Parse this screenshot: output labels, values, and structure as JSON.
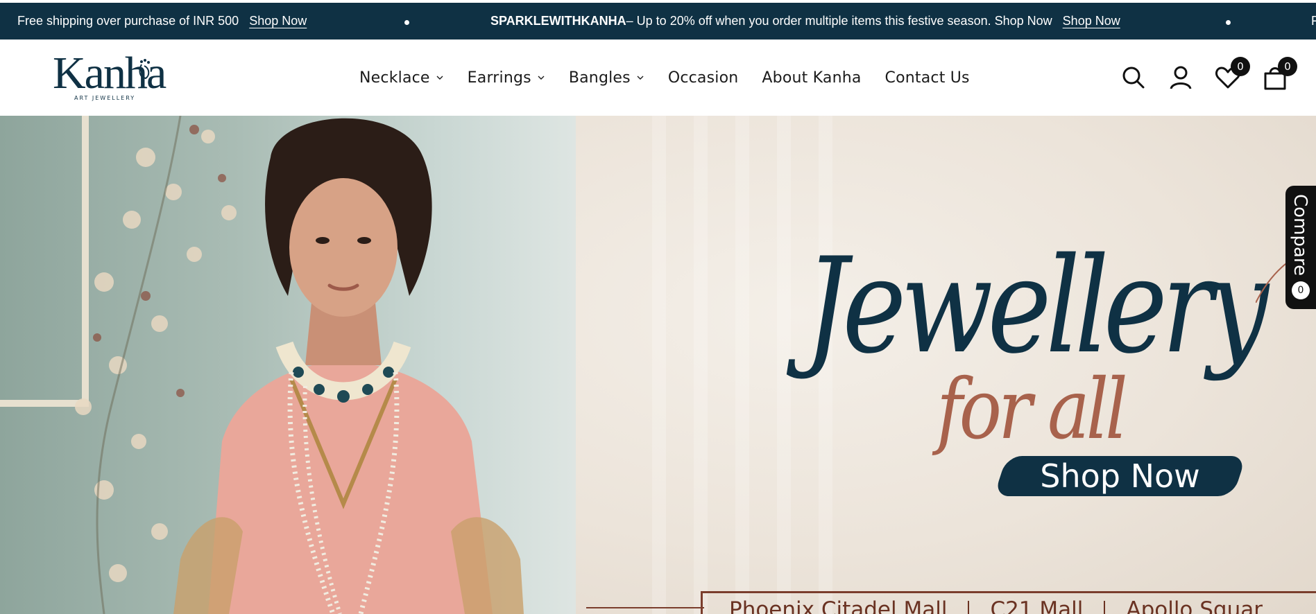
{
  "announcement": {
    "items": [
      {
        "text": "Free shipping over purchase of INR 500",
        "link": "Shop Now"
      },
      {
        "bold": "SPARKLEWITHKANHA",
        "text": "– Up to 20% off when you order multiple items this festive season. Shop Now",
        "link": "Shop Now"
      }
    ],
    "trailing_fragment": "F"
  },
  "header": {
    "logo": {
      "name": "Kanha",
      "tagline": "ART JEWELLERY"
    },
    "nav": [
      {
        "label": "Necklace",
        "has_dropdown": true
      },
      {
        "label": "Earrings",
        "has_dropdown": true
      },
      {
        "label": "Bangles",
        "has_dropdown": true
      },
      {
        "label": "Occasion",
        "has_dropdown": false
      },
      {
        "label": "About Kanha",
        "has_dropdown": false
      },
      {
        "label": "Contact Us",
        "has_dropdown": false
      }
    ],
    "icons": {
      "search": "search-icon",
      "account": "account-icon",
      "wishlist": "heart-icon",
      "cart": "shopping-bag-icon"
    },
    "wishlist_count": "0",
    "cart_count": "0"
  },
  "hero": {
    "headline": "Jewellery",
    "subheadline": "for all",
    "cta": "Shop Now",
    "locations": [
      "Phoenix Citadel Mall",
      "C21 Mall",
      "Apollo Squar"
    ]
  },
  "compare": {
    "label": "Compare",
    "count": "0"
  },
  "colors": {
    "brand_navy": "#0f3144",
    "accent_rose": "#a8624c",
    "badge_black": "#111111"
  }
}
